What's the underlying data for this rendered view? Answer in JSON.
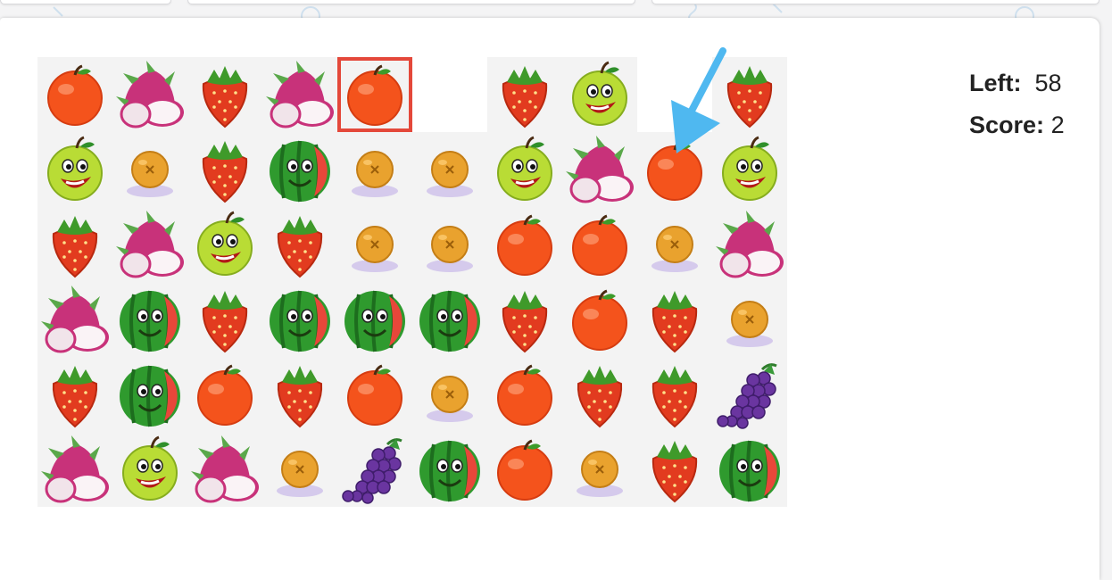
{
  "game": {
    "columns": 10,
    "grid": [
      [
        "apple",
        "dragonfruit",
        "strawberry",
        "dragonfruit",
        "apple",
        "empty",
        "strawberry",
        "green_apple",
        "empty",
        "strawberry"
      ],
      [
        "green_apple",
        "orange",
        "strawberry",
        "watermelon",
        "orange",
        "orange",
        "green_apple",
        "dragonfruit",
        "apple",
        "green_apple"
      ],
      [
        "strawberry",
        "dragonfruit",
        "green_apple",
        "strawberry",
        "orange",
        "orange",
        "apple",
        "apple",
        "orange",
        "dragonfruit"
      ],
      [
        "dragonfruit",
        "watermelon",
        "strawberry",
        "watermelon",
        "watermelon",
        "watermelon",
        "strawberry",
        "apple",
        "strawberry",
        "orange"
      ],
      [
        "strawberry",
        "watermelon",
        "apple",
        "strawberry",
        "apple",
        "orange",
        "apple",
        "strawberry",
        "strawberry",
        "grapes"
      ],
      [
        "dragonfruit",
        "green_apple",
        "dragonfruit",
        "orange",
        "grapes",
        "watermelon",
        "apple",
        "orange",
        "strawberry",
        "watermelon"
      ]
    ],
    "selected": {
      "row": 0,
      "col": 4
    },
    "hint_target": {
      "row": 1,
      "col": 8
    }
  },
  "stats": {
    "left_label": "Left:",
    "left_value": "58",
    "score_label": "Score:",
    "score_value": "2"
  },
  "colors": {
    "selection": "#e4483a",
    "hint_arrow": "#4fb8f0",
    "tile_bg": "#f3f3f3"
  },
  "icons": {
    "apple": "red-apple-icon",
    "green_apple": "green-apple-smiley-icon",
    "strawberry": "strawberry-icon",
    "dragonfruit": "dragon-fruit-icon",
    "orange": "orange-icon",
    "watermelon": "watermelon-smiley-icon",
    "grapes": "grapes-icon"
  }
}
